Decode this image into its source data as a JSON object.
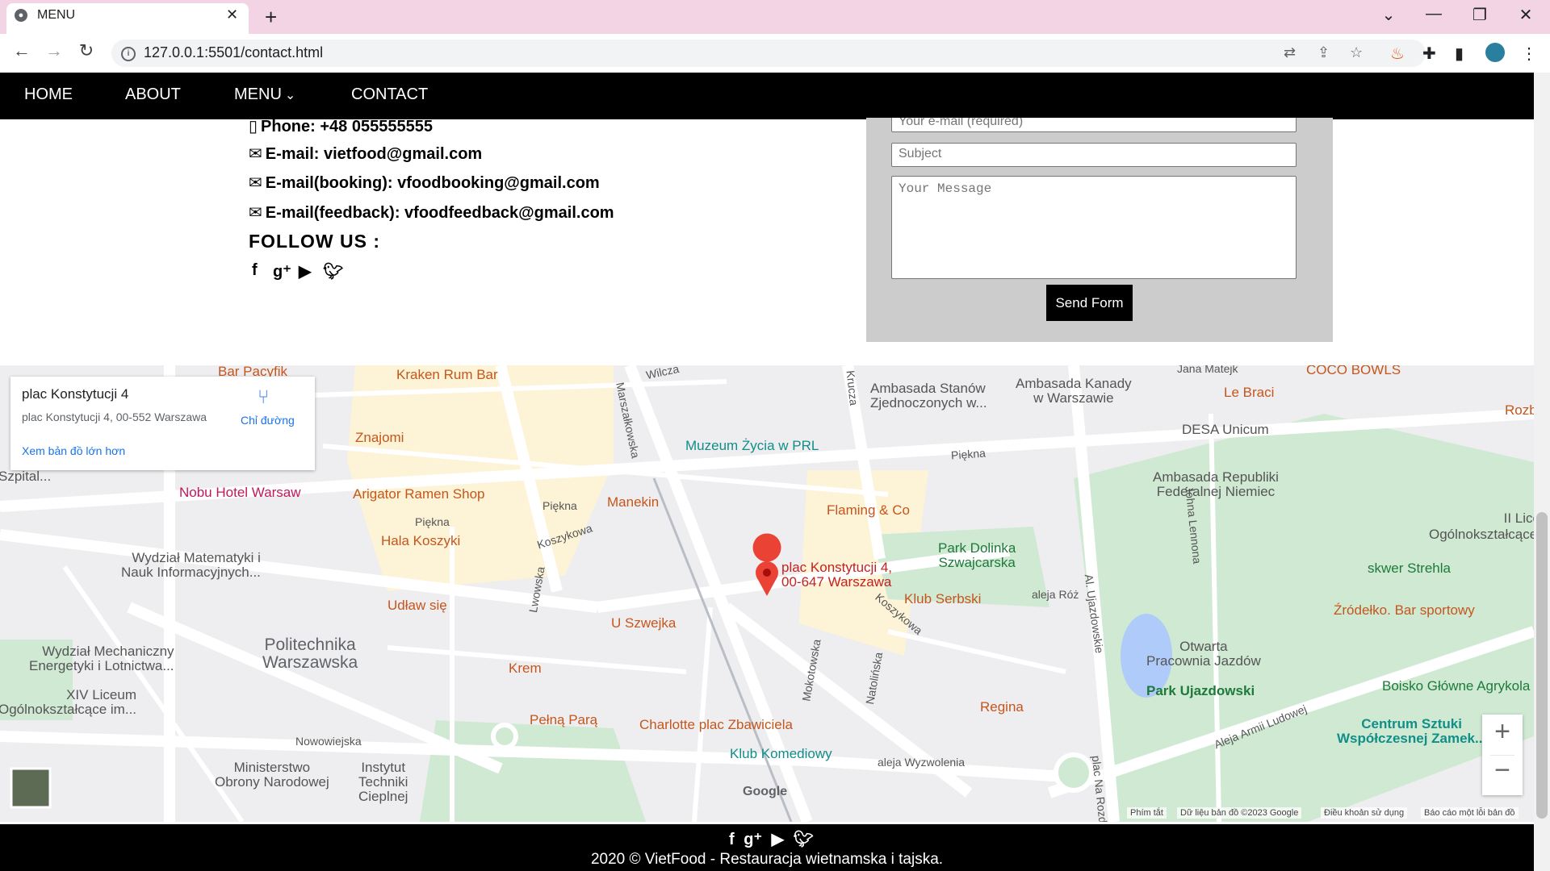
{
  "browser": {
    "tab_title": "MENU",
    "tab_close": "✕",
    "new_tab": "+",
    "url": "127.0.0.1:5501/contact.html",
    "window_controls": {
      "dropdown": "⌄",
      "minimize": "—",
      "restore": "❐",
      "close": "✕"
    },
    "nav": {
      "back": "←",
      "forward": "→",
      "reload": "↻"
    }
  },
  "site_nav": {
    "items": [
      {
        "label": "HOME"
      },
      {
        "label": "ABOUT"
      },
      {
        "label": "MENU"
      },
      {
        "label": "CONTACT"
      }
    ],
    "menu_caret": "⌄"
  },
  "contact": {
    "phone": "Phone: +48 055555555",
    "email": "E-mail: vietfood@gmail.com",
    "email_booking": "E-mail(booking): vfoodbooking@gmail.com",
    "email_feedback": "E-mail(feedback): vfoodfeedback@gmail.com",
    "follow_title": "FOLLOW US :",
    "social_icons": [
      "facebook-icon",
      "google-plus-icon",
      "youtube-icon",
      "twitter-icon"
    ]
  },
  "form": {
    "email_placeholder": "Your e-mail (required)",
    "subject_placeholder": "Subject",
    "message_placeholder": "Your Message",
    "send_label": "Send Form"
  },
  "map": {
    "card": {
      "title": "plac Konstytucji 4",
      "address": "plac Konstytucji 4, 00-552 Warszawa",
      "directions_label": "Chỉ đường",
      "larger_map_link": "Xem bản đồ lớn hơn"
    },
    "marker_label": [
      "plac Konstytucji 4,",
      "00-647 Warszawa"
    ],
    "places": {
      "bar_pacyfik": "Bar Pacyfik",
      "kraken": "Kraken Rum Bar",
      "wilcza": "Wilcza",
      "ambasada_stanow": [
        "Ambasada Stanów",
        "Zjednoczonych w..."
      ],
      "ambasada_kanady": [
        "Ambasada Kanady",
        "w Warszawie"
      ],
      "le_braci": "Le Braci",
      "coco_bowls": "COCO BOWLS",
      "rozb": "Rozb",
      "szpital": "Szpital...",
      "znajomi": "Znajomi",
      "muzeum": "Muzeum Życia w PRL",
      "desa": "DESA Unicum",
      "piekna_east": "Piękna",
      "nobu": "Nobu Hotel Warsaw",
      "arigator": "Arigator Ramen Shop",
      "ambasada_niemiec": [
        "Ambasada Republiki",
        "Federalnej Niemiec"
      ],
      "manekin": "Manekin",
      "piekna_west": "Piękna",
      "piekna_mid": "Piękna",
      "flaming": "Flaming & Co",
      "liceum": [
        "II Liceu",
        "Ogólnokształcące z"
      ],
      "hala_koszyki": "Hala Koszyki",
      "koszykowa_west": "Koszykowa",
      "park_dolinka": [
        "Park Dolinka",
        "Szwajcarska"
      ],
      "wydzial_mat": [
        "Wydział Matematyki i",
        "Nauk Informacyjnych..."
      ],
      "skwer": "skwer Strehla",
      "udlaw": "Udław się",
      "lwowska": "Lwowska",
      "klub_serbski": "Klub Serbski",
      "aleja_roz": "aleja Róż",
      "zrodelko": "Źródełko. Bar sportowy",
      "u_szwejka": "U Szwejka",
      "koszykowa_east": "Koszykowa",
      "wydzial_mech": [
        "Wydział Mechaniczny",
        "Energetyki i Lotnictwa..."
      ],
      "politechnika": [
        "Politechnika",
        "Warszawska"
      ],
      "otwarta": [
        "Otwarta",
        "Pracownia Jazdów"
      ],
      "krem": "Krem",
      "park_ujazdowski": "Park Ujazdowski",
      "boisko": "Boisko Główne Agrykola",
      "xiv_liceum": [
        "XIV Liceum",
        "Ogólnokształcące im..."
      ],
      "regina": "Regina",
      "pelna_para": "Pełną Parą",
      "charlotte": "Charlotte plac Zbawiciela",
      "centrum": [
        "Centrum Sztuki",
        "Współczesnej Zamek..."
      ],
      "nowowiejska": "Nowowiejska",
      "klub_komediowy": "Klub Komediowy",
      "aleja_wyzwolenia": "aleja Wyzwolenia",
      "aleja_armii": "Aleja Armii Ludowej",
      "ministerstwo": [
        "Ministerstwo",
        "Obrony Narodowej"
      ],
      "instytut": [
        "Instytut",
        "Techniki",
        "Cieplnej"
      ],
      "marszalkowska": "Marszałkowska",
      "krucza": "Krucza",
      "mokotowska": "Mokotowska",
      "natolinska": "Natolińska",
      "johna_lennona": "Johna Lennona",
      "al_ujazdowskie": "Al. Ujazdowskie",
      "plac_na_rozdrozu": "plac Na Rozdr",
      "jana": "Jana Matejk"
    },
    "google_logo": "Google",
    "footer_links": [
      "Phím tắt",
      "Dữ liệu bản đồ ©2023 Google",
      "Điều khoản sử dụng",
      "Báo cáo một lỗi bản đồ"
    ],
    "zoom_in": "+",
    "zoom_out": "−"
  },
  "footer": {
    "text": "2020 © VietFood - Restauracja wietnamska i tajska."
  }
}
